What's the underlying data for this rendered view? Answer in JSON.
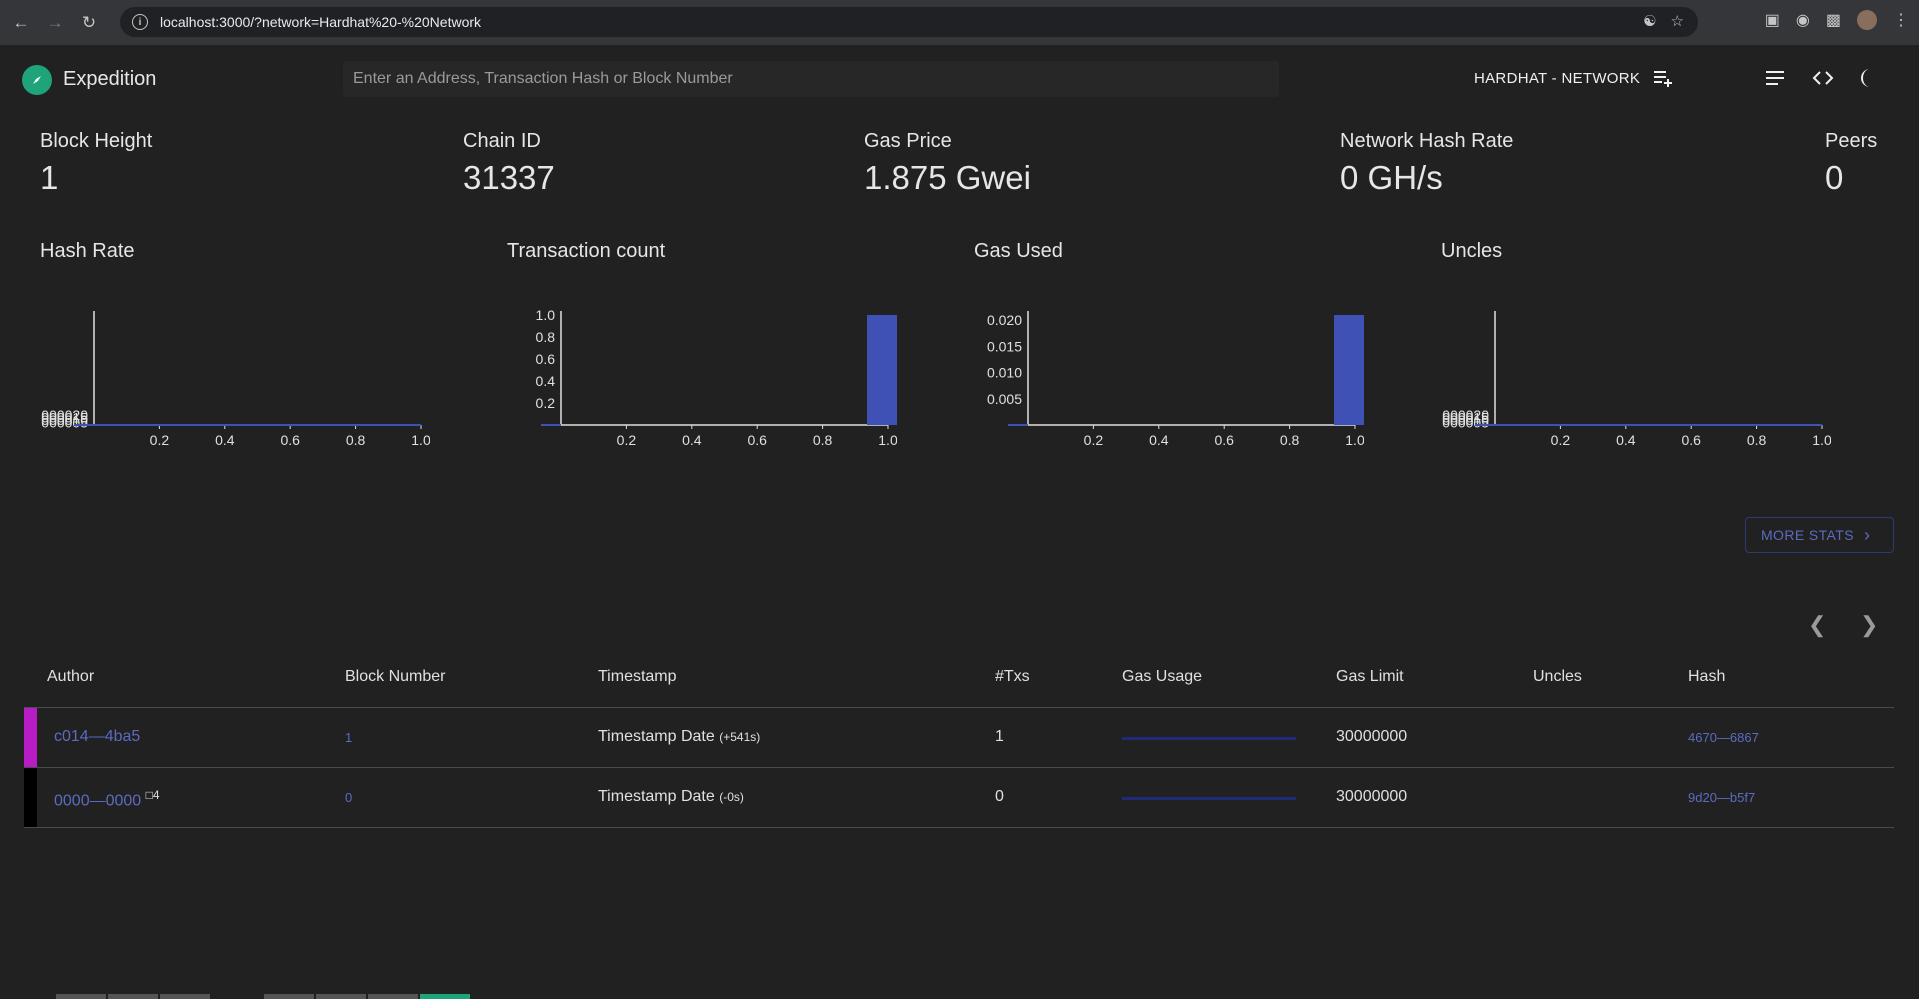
{
  "browser": {
    "url": "localhost:3000/?network=Hardhat%20-%20Network"
  },
  "app": {
    "title": "Expedition",
    "search_placeholder": "Enter an Address, Transaction Hash or Block Number",
    "network_label": "HARDHAT - NETWORK"
  },
  "stats": [
    {
      "label": "Block Height",
      "value": "1"
    },
    {
      "label": "Chain ID",
      "value": "31337"
    },
    {
      "label": "Gas Price",
      "value": "1.875 Gwei"
    },
    {
      "label": "Network Hash Rate",
      "value": "0 GH/s"
    },
    {
      "label": "Peers",
      "value": "0"
    }
  ],
  "chart_data": [
    {
      "type": "line",
      "title": "Hash Rate",
      "x": [
        0,
        1
      ],
      "series": [
        {
          "values": [
            0,
            0
          ]
        }
      ],
      "x_ticks": [
        "0.2",
        "0.4",
        "0.6",
        "0.8",
        "1.0"
      ],
      "y_ticks": [
        "000005",
        "000010",
        "000015",
        "000020"
      ],
      "xlim": [
        0,
        1
      ],
      "ylim": [
        0,
        2.2e-05
      ]
    },
    {
      "type": "bar",
      "title": "Transaction count",
      "x": [
        0,
        1
      ],
      "values": [
        0,
        1
      ],
      "x_ticks": [
        "0.2",
        "0.4",
        "0.6",
        "0.8",
        "1.0"
      ],
      "y_ticks": [
        "0.2",
        "0.4",
        "0.6",
        "0.8",
        "1.0"
      ],
      "xlim": [
        0,
        1
      ],
      "ylim": [
        0,
        1
      ]
    },
    {
      "type": "bar",
      "title": "Gas Used",
      "x": [
        0,
        1
      ],
      "values": [
        0,
        0.021
      ],
      "x_ticks": [
        "0.2",
        "0.4",
        "0.6",
        "0.8",
        "1.0"
      ],
      "y_ticks": [
        "0.005",
        "0.010",
        "0.015",
        "0.020"
      ],
      "xlim": [
        0,
        1
      ],
      "ylim": [
        0,
        0.021
      ]
    },
    {
      "type": "line",
      "title": "Uncles",
      "x": [
        0,
        1
      ],
      "series": [
        {
          "values": [
            0,
            0
          ]
        }
      ],
      "x_ticks": [
        "0.2",
        "0.4",
        "0.6",
        "0.8",
        "1.0"
      ],
      "y_ticks": [
        "000005",
        "000010",
        "000015",
        "000020"
      ],
      "xlim": [
        0,
        1
      ],
      "ylim": [
        0,
        2.2e-05
      ]
    }
  ],
  "more_stats_label": "MORE STATS",
  "table": {
    "headers": {
      "author": "Author",
      "block_number": "Block Number",
      "timestamp": "Timestamp",
      "txs": "#Txs",
      "gas_usage": "Gas Usage",
      "gas_limit": "Gas Limit",
      "uncles": "Uncles",
      "hash": "Hash"
    },
    "rows": [
      {
        "author": "c014—4ba5",
        "author_color": "#b81cc4",
        "uncle_mark": "",
        "block_number": "1",
        "timestamp": "Timestamp Date",
        "timestamp_delta": "(+541s)",
        "txs": "1",
        "gas_usage": 0,
        "gas_limit": "30000000",
        "uncles": "",
        "hash": "4670—6867"
      },
      {
        "author": "0000—0000",
        "author_color": "#000000",
        "uncle_mark": "□4",
        "block_number": "0",
        "timestamp": "Timestamp Date",
        "timestamp_delta": "(-0s)",
        "txs": "0",
        "gas_usage": 0,
        "gas_limit": "30000000",
        "uncles": "",
        "hash": "9d20—b5f7"
      }
    ]
  }
}
